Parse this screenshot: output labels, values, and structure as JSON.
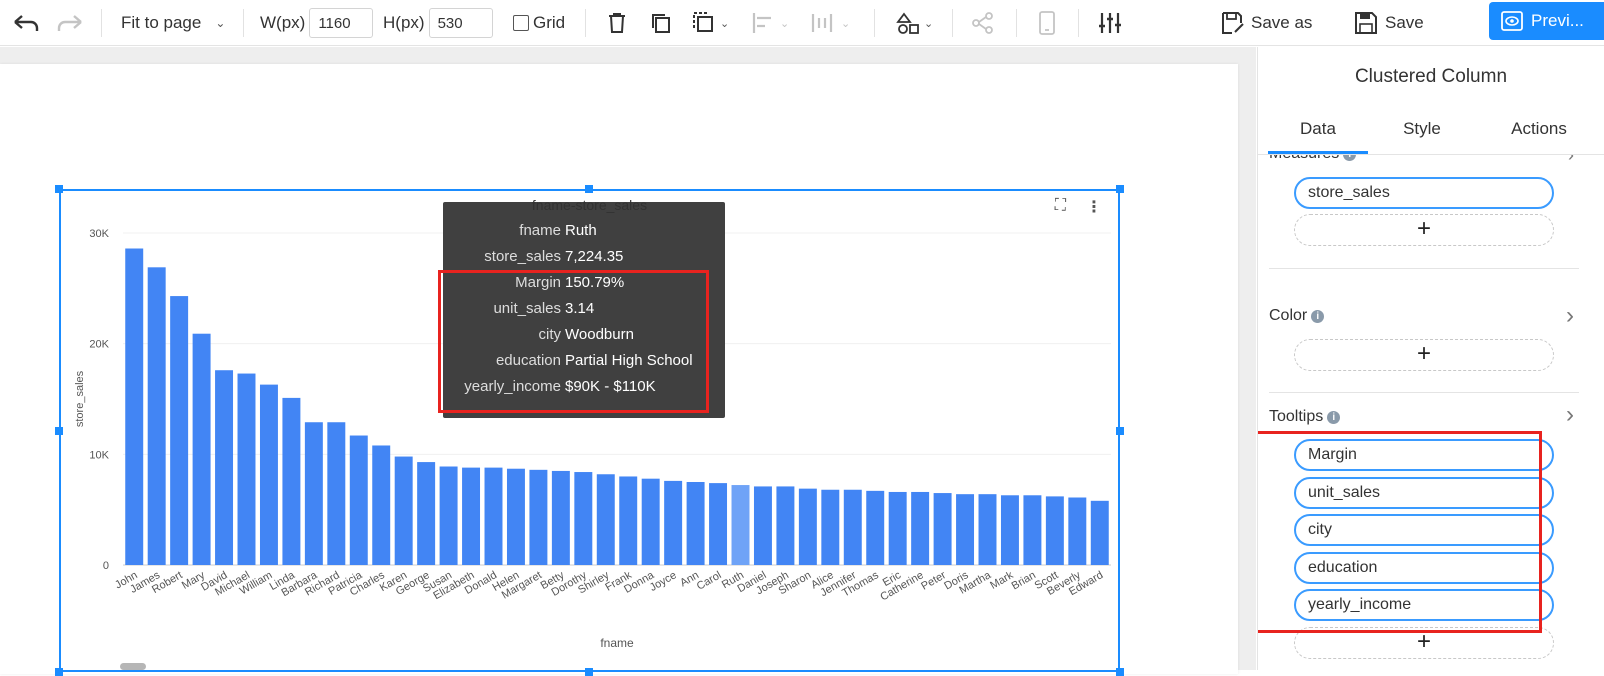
{
  "toolbar": {
    "fit_label": "Fit to page",
    "width_label": "W(px)",
    "width_value": "1160",
    "height_label": "H(px)",
    "height_value": "530",
    "grid_label": "Grid",
    "save_as_label": "Save as",
    "save_label": "Save",
    "preview_label": "Previ..."
  },
  "widget": {
    "title": "fname-store_sales",
    "ylabel": "store_sales",
    "xlabel": "fname"
  },
  "tooltip": {
    "rows": [
      {
        "key": "fname",
        "value": "Ruth"
      },
      {
        "key": "store_sales",
        "value": "7,224.35"
      },
      {
        "key": "Margin",
        "value": "150.79%"
      },
      {
        "key": "unit_sales",
        "value": "3.14"
      },
      {
        "key": "city",
        "value": "Woodburn"
      },
      {
        "key": "education",
        "value": "Partial High School"
      },
      {
        "key": "yearly_income",
        "value": "$90K - $110K"
      }
    ]
  },
  "panel": {
    "title": "Clustered Column",
    "tabs": [
      "Data",
      "Style",
      "Actions"
    ],
    "measures_label": "Measures",
    "measures": [
      "store_sales"
    ],
    "color_label": "Color",
    "tooltips_label": "Tooltips",
    "tooltips": [
      "Margin",
      "unit_sales",
      "city",
      "education",
      "yearly_income"
    ],
    "add_symbol": "+"
  },
  "colors": {
    "bar": "#4285f4",
    "bar_highlight": "#6fa3f7",
    "accent": "#1a8cff",
    "highlight_box": "#e8231f"
  },
  "chart_data": {
    "type": "bar",
    "title": "fname-store_sales",
    "xlabel": "fname",
    "ylabel": "store_sales",
    "ylim": [
      0,
      30000
    ],
    "yticks": [
      "0",
      "10K",
      "20K",
      "30K"
    ],
    "highlighted": "Ruth",
    "categories": [
      "John",
      "James",
      "Robert",
      "Mary",
      "David",
      "Michael",
      "William",
      "Linda",
      "Barbara",
      "Richard",
      "Patricia",
      "Charles",
      "Karen",
      "George",
      "Susan",
      "Elizabeth",
      "Donald",
      "Helen",
      "Margaret",
      "Betty",
      "Dorothy",
      "Shirley",
      "Frank",
      "Donna",
      "Joyce",
      "Ann",
      "Carol",
      "Ruth",
      "Daniel",
      "Joseph",
      "Sharon",
      "Alice",
      "Jennifer",
      "Thomas",
      "Eric",
      "Catherine",
      "Peter",
      "Doris",
      "Martha",
      "Mark",
      "Brian",
      "Scott",
      "Beverly",
      "Edward"
    ],
    "values": [
      28600,
      26900,
      24300,
      20900,
      17600,
      17300,
      16300,
      15100,
      12900,
      12900,
      11700,
      10800,
      9800,
      9300,
      8900,
      8800,
      8800,
      8700,
      8600,
      8500,
      8400,
      8200,
      8000,
      7800,
      7600,
      7500,
      7400,
      7224.35,
      7100,
      7100,
      6900,
      6800,
      6800,
      6700,
      6600,
      6600,
      6500,
      6400,
      6400,
      6300,
      6300,
      6200,
      6100,
      5800,
      5700
    ]
  }
}
